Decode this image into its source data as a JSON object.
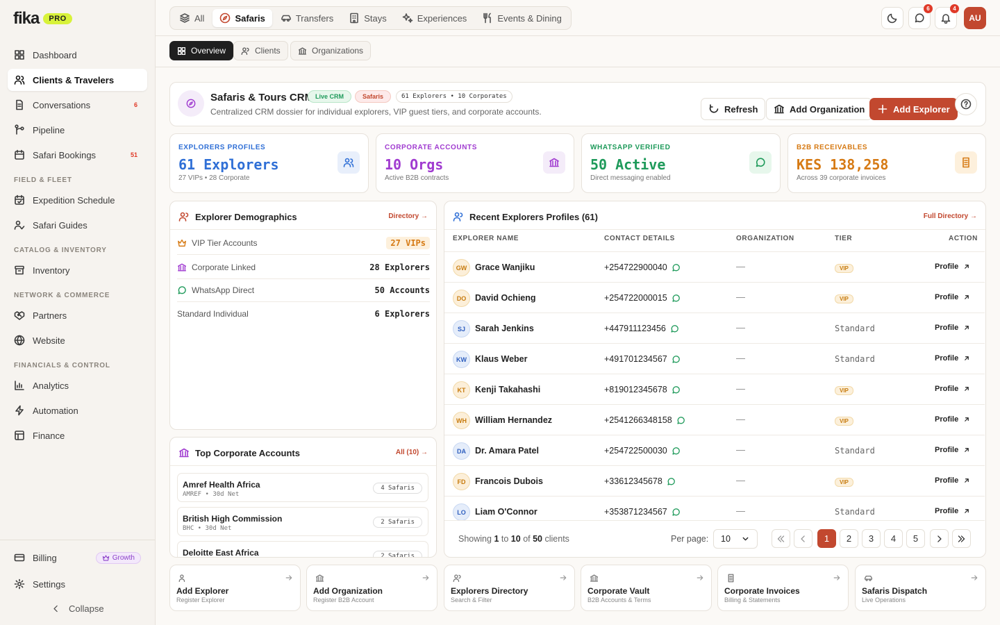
{
  "brand": {
    "name": "fika",
    "tier": "PRO"
  },
  "sidebar": {
    "items": [
      {
        "label": "Dashboard"
      },
      {
        "label": "Clients & Travelers"
      },
      {
        "label": "Conversations",
        "badge": "6"
      },
      {
        "label": "Pipeline"
      },
      {
        "label": "Safari Bookings",
        "badge": "51"
      },
      {
        "label": "Expedition Schedule"
      },
      {
        "label": "Safari Guides"
      },
      {
        "label": "Inventory"
      },
      {
        "label": "Partners"
      },
      {
        "label": "Website"
      },
      {
        "label": "Analytics"
      },
      {
        "label": "Automation"
      },
      {
        "label": "Finance"
      }
    ],
    "sections": [
      "FIELD & FLEET",
      "CATALOG & INVENTORY",
      "NETWORK & COMMERCE",
      "FINANCIALS & CONTROL"
    ],
    "billing": {
      "label": "Billing",
      "plan": "Growth"
    },
    "settings": "Settings",
    "collapse": "Collapse"
  },
  "topbar": {
    "tabs": [
      "All",
      "Safaris",
      "Transfers",
      "Stays",
      "Experiences",
      "Events & Dining"
    ],
    "messages_badge": "6",
    "notifications_badge": "4",
    "avatar": "AU"
  },
  "subtabs": [
    "Overview",
    "Clients",
    "Organizations"
  ],
  "header": {
    "title": "Safaris & Tours CRM",
    "live": "Live CRM",
    "category": "Safaris",
    "counts": "61 Explorers • 10 Corporates",
    "description": "Centralized CRM dossier for individual explorers, VIP guest tiers, and corporate accounts.",
    "refresh": "Refresh",
    "add_org": "Add Organization",
    "add_explorer": "Add Explorer"
  },
  "kpis": [
    {
      "label": "EXPLORERS PROFILES",
      "value": "61 Explorers",
      "sub": "27 VIPs • 28 Corporate",
      "color": "#2f6fd6"
    },
    {
      "label": "CORPORATE ACCOUNTS",
      "value": "10 Orgs",
      "sub": "Active B2B contracts",
      "color": "#a03bd0"
    },
    {
      "label": "WHATSAPP VERIFIED",
      "value": "50 Active",
      "sub": "Direct messaging enabled",
      "color": "#1e9a5a"
    },
    {
      "label": "B2B RECEIVABLES",
      "value": "KES 138,258",
      "sub": "Across 39 corporate invoices",
      "color": "#d67a14"
    }
  ],
  "demographics": {
    "title": "Explorer Demographics",
    "link": "Directory →",
    "rows": [
      {
        "label": "VIP Tier Accounts",
        "value": "27 VIPs"
      },
      {
        "label": "Corporate Linked",
        "value": "28 Explorers"
      },
      {
        "label": "WhatsApp Direct",
        "value": "50 Accounts"
      },
      {
        "label": "Standard Individual",
        "value": "6 Explorers"
      }
    ]
  },
  "corporate": {
    "title": "Top Corporate Accounts",
    "link": "All (10) →",
    "items": [
      {
        "name": "Amref Health Africa",
        "meta": "AMREF • 30d Net",
        "count": "4 Safaris"
      },
      {
        "name": "British High Commission",
        "meta": "BHC • 30d Net",
        "count": "2 Safaris"
      },
      {
        "name": "Deloitte East Africa",
        "meta": "",
        "count": "2 Safaris"
      }
    ]
  },
  "explorers": {
    "title": "Recent Explorers Profiles (61)",
    "link": "Full Directory →",
    "columns": [
      "EXPLORER NAME",
      "CONTACT DETAILS",
      "ORGANIZATION",
      "TIER",
      "ACTION"
    ],
    "rows": [
      {
        "initials": "GW",
        "name": "Grace Wanjiku",
        "phone": "+254722900040",
        "org": "—",
        "tier": "VIP",
        "action": "Profile"
      },
      {
        "initials": "DO",
        "name": "David Ochieng",
        "phone": "+254722000015",
        "org": "—",
        "tier": "VIP",
        "action": "Profile"
      },
      {
        "initials": "SJ",
        "name": "Sarah Jenkins",
        "phone": "+447911123456",
        "org": "—",
        "tier": "Standard",
        "action": "Profile"
      },
      {
        "initials": "KW",
        "name": "Klaus Weber",
        "phone": "+491701234567",
        "org": "—",
        "tier": "Standard",
        "action": "Profile"
      },
      {
        "initials": "KT",
        "name": "Kenji Takahashi",
        "phone": "+819012345678",
        "org": "—",
        "tier": "VIP",
        "action": "Profile"
      },
      {
        "initials": "WH",
        "name": "William Hernandez",
        "phone": "+2541266348158",
        "org": "—",
        "tier": "VIP",
        "action": "Profile"
      },
      {
        "initials": "DA",
        "name": "Dr. Amara Patel",
        "phone": "+254722500030",
        "org": "—",
        "tier": "Standard",
        "action": "Profile"
      },
      {
        "initials": "FD",
        "name": "Francois Dubois",
        "phone": "+33612345678",
        "org": "—",
        "tier": "VIP",
        "action": "Profile"
      },
      {
        "initials": "LO",
        "name": "Liam O'Connor",
        "phone": "+353871234567",
        "org": "—",
        "tier": "Standard",
        "action": "Profile"
      }
    ],
    "pagination": {
      "showing": "Showing",
      "from": "1",
      "to_word": "to",
      "to": "10",
      "of_word": "of",
      "total": "50",
      "unit": "clients",
      "per_page_label": "Per page:",
      "per_page": "10",
      "pages": [
        "1",
        "2",
        "3",
        "4",
        "5"
      ],
      "current": "1"
    }
  },
  "quick_actions": [
    {
      "title": "Add Explorer",
      "sub": "Register Explorer"
    },
    {
      "title": "Add Organization",
      "sub": "Register B2B Account"
    },
    {
      "title": "Explorers Directory",
      "sub": "Search & Filter"
    },
    {
      "title": "Corporate Vault",
      "sub": "B2B Accounts & Terms"
    },
    {
      "title": "Corporate Invoices",
      "sub": "Billing & Statements"
    },
    {
      "title": "Safaris Dispatch",
      "sub": "Live Operations"
    }
  ]
}
